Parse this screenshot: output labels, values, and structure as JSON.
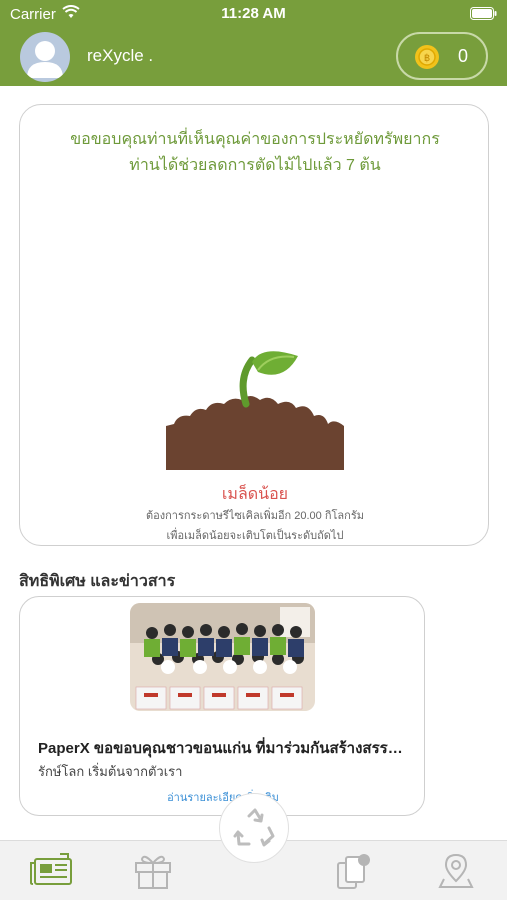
{
  "status_bar": {
    "carrier": "Carrier",
    "time": "11:28 AM"
  },
  "header": {
    "username": "reXycle .",
    "coin_count": "0"
  },
  "hero": {
    "thanks_line_1": "ขอขอบคุณท่านที่เห็นคุณค่าของการประหยัดทรัพยากร",
    "thanks_line_2": "ท่านได้ช่วยลดการตัดไม้ไปแล้ว 7 ต้น",
    "level_name": "เมล็ดน้อย",
    "level_note_1": "ต้องการกระดาษรีไซเคิลเพิ่มอีก 20.00 กิโลกรัม",
    "level_note_2": "เพื่อเมล็ดน้อยจะเติบโตเป็นระดับถัดไป"
  },
  "news": {
    "section_title": "สิทธิพิเศษ และข่าวสาร",
    "items": [
      {
        "title": "PaperX ขอขอบคุณชาวขอนแก่น ที่มาร่วมกันสร้างสรรค์...",
        "subtitle": "รักษ์โลก เริ่มต้นจากตัวเรา",
        "more_label": "อ่านรายละเอียดเพิ่มเติม"
      }
    ]
  },
  "tab_bar": {
    "tabs": [
      "news-icon",
      "gift-icon",
      "recycle-icon",
      "cards-icon",
      "map-pin-icon"
    ],
    "active_color": "#789e3c",
    "inactive_color": "#b5b5b5"
  },
  "colors": {
    "brand_green": "#789e3c",
    "accent_red": "#d9534f",
    "link_blue": "#3a8fd6"
  }
}
